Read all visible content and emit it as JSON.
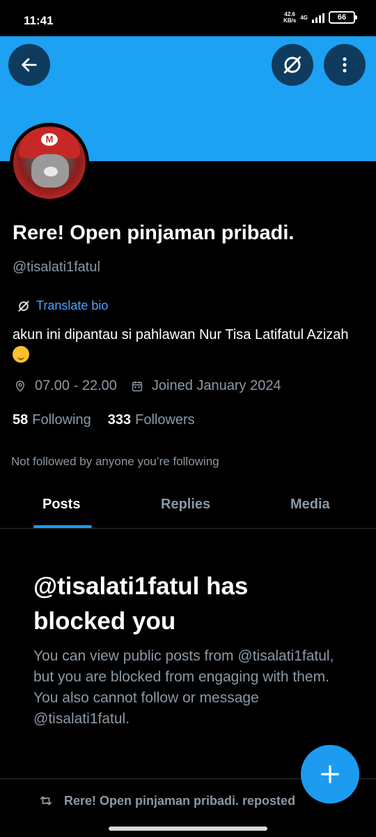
{
  "status_bar": {
    "time": "11:41",
    "speed_value": "42.6",
    "speed_unit": "KB/s",
    "network": "4G",
    "battery": "66"
  },
  "header": {
    "banner_color": "#1da1f2",
    "back_icon": "arrow-left-icon",
    "translate_icon": "translate-icon",
    "more_icon": "more-vertical-icon"
  },
  "profile": {
    "name": "Rere! Open pinjaman pribadi.",
    "handle": "@tisalati1fatul",
    "translate_bio": "Translate bio",
    "bio": "akun ini dipantau si pahlawan Nur Tisa Latifatul Azizah",
    "location": "07.00 - 22.00",
    "joined": "Joined January 2024",
    "following_count": "58",
    "following_label": "Following",
    "followers_count": "333",
    "followers_label": "Followers",
    "not_followed_text": "Not followed by anyone you’re following"
  },
  "tabs": [
    {
      "label": "Posts",
      "active": true
    },
    {
      "label": "Replies",
      "active": false
    },
    {
      "label": "Media",
      "active": false
    }
  ],
  "blocked": {
    "title": "@tisalati1fatul has blocked you",
    "message": "You can view public posts from @tisalati1fatul, but you are blocked from engaging with them. You also cannot follow or message @tisalati1fatul."
  },
  "feed": {
    "repost_text": "Rere! Open pinjaman pribadi. reposted"
  },
  "colors": {
    "accent": "#1d9bf0",
    "secondary_text": "#8b98a5",
    "background": "#000000"
  }
}
